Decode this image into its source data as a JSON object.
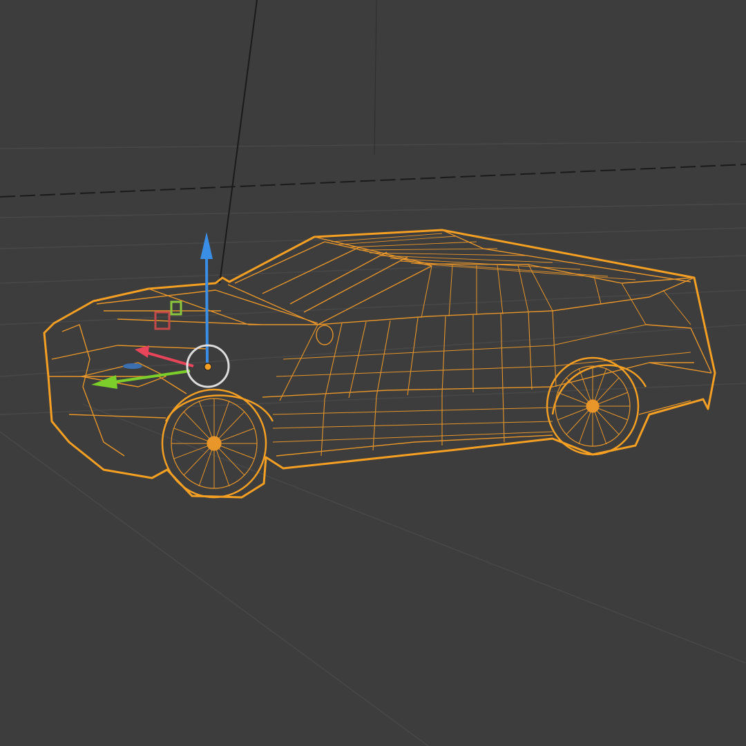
{
  "viewport": {
    "mode": "wireframe",
    "background_color": "#3d3d3d",
    "grid_color": "#4a4a4a",
    "axis_line_color": "#1a1a1a"
  },
  "selected_object": {
    "type": "car-mesh",
    "outline_color": "#f5a023",
    "wire_color": "#e8962a",
    "selected": true
  },
  "gizmo": {
    "z_axis_color": "#3a8ee6",
    "x_axis_color": "#e8445a",
    "y_axis_color": "#7ccf2a",
    "pivot_color": "#f5a023",
    "rotate_ring_color": "#dddddd"
  },
  "light": {
    "markers": [
      {
        "name": "red",
        "color": "#c44a4a"
      },
      {
        "name": "green",
        "color": "#8cc63e"
      }
    ]
  }
}
